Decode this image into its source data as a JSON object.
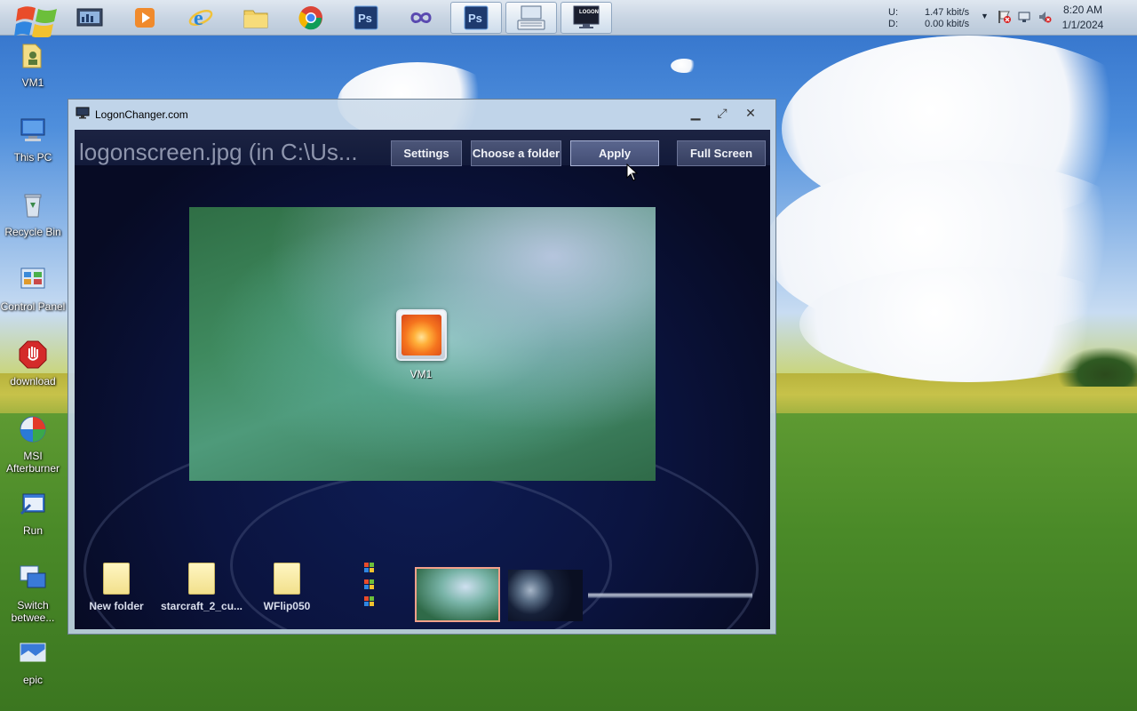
{
  "taskbar": {
    "pinned": [
      {
        "name": "task-manager-icon"
      },
      {
        "name": "media-player-icon"
      },
      {
        "name": "internet-explorer-icon"
      },
      {
        "name": "file-explorer-icon"
      },
      {
        "name": "chrome-icon"
      },
      {
        "name": "photoshop-icon"
      },
      {
        "name": "infinity-app-icon"
      },
      {
        "name": "photoshop-running-icon"
      },
      {
        "name": "keyboard-app-icon"
      },
      {
        "name": "logon-changer-icon"
      }
    ],
    "logon_badge": "LOGON",
    "network": {
      "up_label": "U:",
      "up_value": "1.47 kbit/s",
      "down_label": "D:",
      "down_value": "0.00 kbit/s"
    },
    "clock": {
      "time": "8:20 AM",
      "date": "1/1/2024"
    }
  },
  "desktop": {
    "icons": [
      {
        "label": "VM1"
      },
      {
        "label": "This PC"
      },
      {
        "label": "Recycle Bin"
      },
      {
        "label": "Control Panel"
      },
      {
        "label": "download"
      },
      {
        "label": "MSI Afterburner"
      },
      {
        "label": "Run"
      },
      {
        "label": "Switch betwee..."
      },
      {
        "label": "epic"
      }
    ]
  },
  "window": {
    "title": "LogonChanger.com",
    "current_file": "logonscreen.jpg (in C:\\Us...",
    "buttons": {
      "settings": "Settings",
      "choose_folder": "Choose a folder",
      "apply": "Apply",
      "full_screen": "Full Screen"
    },
    "preview_user": "VM1",
    "strip": {
      "folders": [
        {
          "label": "New folder"
        },
        {
          "label": "starcraft_2_cu..."
        },
        {
          "label": "WFlip050"
        }
      ]
    }
  },
  "colors": {
    "accent": "#363f61",
    "window_bg": "#0b1440"
  }
}
